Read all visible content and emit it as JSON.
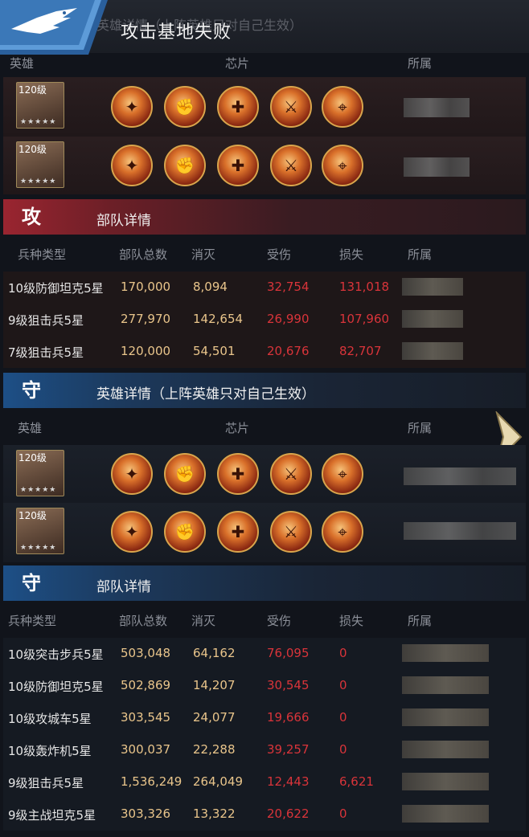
{
  "header": {
    "title": "攻击基地失败",
    "ghost_title": "英雄详情（上阵英雄只对自己生效）"
  },
  "attack": {
    "hero_header": {
      "col_hero": "英雄",
      "col_chip": "芯片",
      "col_owner": "所属"
    },
    "heroes": [
      {
        "level": "120级",
        "stars": "★★★★★"
      },
      {
        "level": "120级",
        "stars": "★★★★★"
      }
    ],
    "badge": "攻",
    "troop_title": "部队详情",
    "troop_header": {
      "type": "兵种类型",
      "total": "部队总数",
      "kill": "消灭",
      "damaged": "受伤",
      "lost": "损失",
      "owner": "所属"
    },
    "troops": [
      {
        "type": "10级防御坦克5星",
        "total": "170,000",
        "kill": "8,094",
        "damaged": "32,754",
        "lost": "131,018"
      },
      {
        "type": "9级狙击兵5星",
        "total": "277,970",
        "kill": "142,654",
        "damaged": "26,990",
        "lost": "107,960"
      },
      {
        "type": "7级狙击兵5星",
        "total": "120,000",
        "kill": "54,501",
        "damaged": "20,676",
        "lost": "82,707"
      }
    ]
  },
  "defense": {
    "badge": "守",
    "hero_title": "英雄详情（上阵英雄只对自己生效）",
    "hero_header": {
      "col_hero": "英雄",
      "col_chip": "芯片",
      "col_owner": "所属"
    },
    "heroes": [
      {
        "level": "120级",
        "stars": "★★★★★"
      },
      {
        "level": "120级",
        "stars": "★★★★★"
      }
    ],
    "troop_title": "部队详情",
    "troop_header": {
      "type": "兵种类型",
      "total": "部队总数",
      "kill": "消灭",
      "damaged": "受伤",
      "lost": "损失",
      "owner": "所属"
    },
    "troops": [
      {
        "type": "10级突击步兵5星",
        "total": "503,048",
        "kill": "64,162",
        "damaged": "76,095",
        "lost": "0"
      },
      {
        "type": "10级防御坦克5星",
        "total": "502,869",
        "kill": "14,207",
        "damaged": "30,545",
        "lost": "0"
      },
      {
        "type": "10级攻城车5星",
        "total": "303,545",
        "kill": "24,077",
        "damaged": "19,666",
        "lost": "0"
      },
      {
        "type": "10级轰炸机5星",
        "total": "300,037",
        "kill": "22,288",
        "damaged": "39,257",
        "lost": "0"
      },
      {
        "type": "9级狙击兵5星",
        "total": "1,536,249",
        "kill": "264,049",
        "damaged": "12,443",
        "lost": "6,621"
      },
      {
        "type": "9级主战坦克5星",
        "total": "303,326",
        "kill": "13,322",
        "damaged": "20,622",
        "lost": "0"
      }
    ]
  },
  "icons": {
    "logo": "eagle-emblem-icon",
    "next": "chevron-right-icon",
    "chips": [
      "chip-flame-icon",
      "chip-fist-icon",
      "chip-target-icon",
      "chip-soldier-icon",
      "chip-rifle-icon"
    ]
  },
  "colors": {
    "attack_accent": "#9a2530",
    "defense_accent": "#1d4f86",
    "value_gold": "#e9c58b",
    "value_red": "#d9343a"
  }
}
